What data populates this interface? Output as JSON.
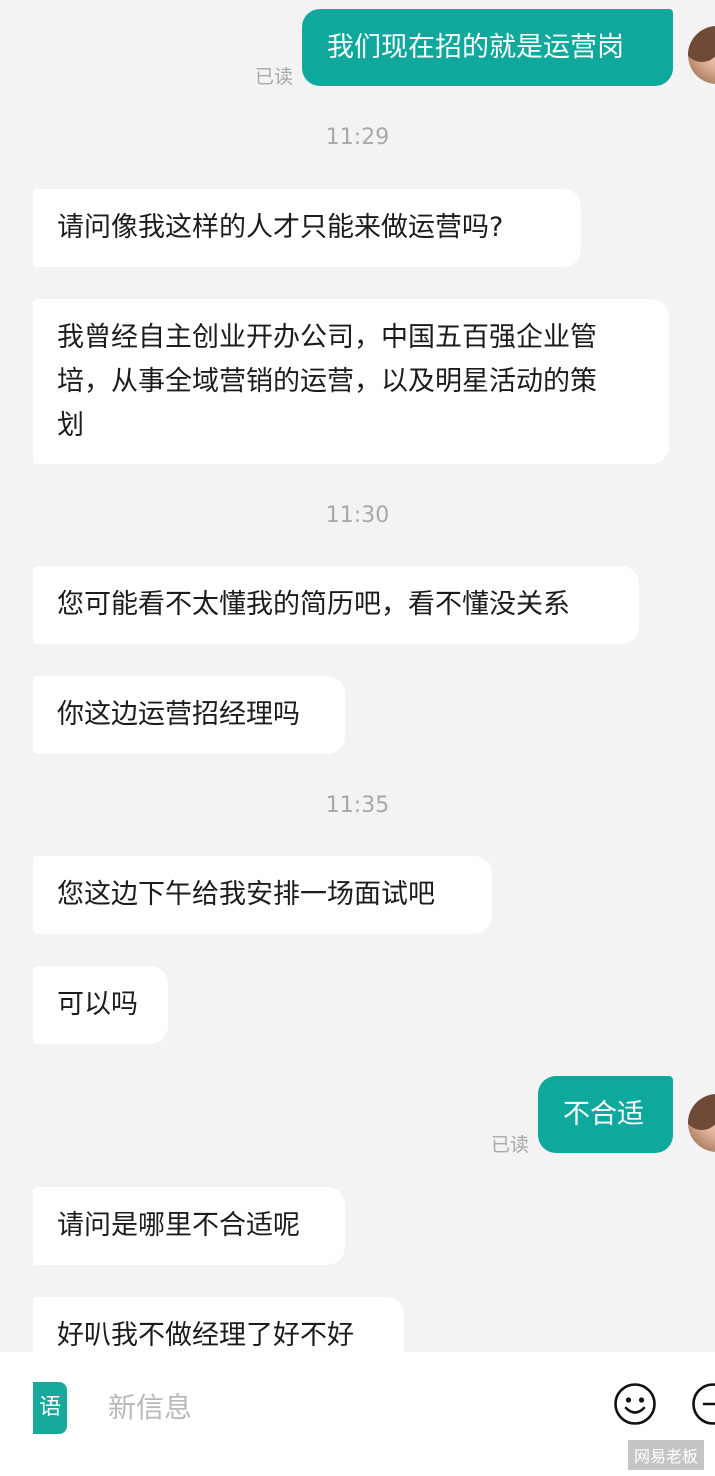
{
  "messages": [
    {
      "text": "我们现在招的就是运营岗",
      "status": "已读"
    },
    {
      "time": "11:29"
    },
    {
      "text": "请问像我这样的人才只能来做运营吗?"
    },
    {
      "lines": [
        "我曾经自主创业开办公司，中国五百强企业管",
        "培，从事全域营销的运营，以及明星活动的策",
        "划"
      ]
    },
    {
      "time": "11:30"
    },
    {
      "text": "您可能看不太懂我的简历吧，看不懂没关系"
    },
    {
      "text": "你这边运营招经理吗"
    },
    {
      "time": "11:35"
    },
    {
      "text": "您这边下午给我安排一场面试吧"
    },
    {
      "text": "可以吗"
    },
    {
      "text": "不合适",
      "status": "已读"
    },
    {
      "text": "请问是哪里不合适呢"
    },
    {
      "text": "好叭我不做经理了好不好"
    }
  ],
  "input": {
    "voice_label": "语",
    "placeholder": "新信息"
  },
  "watermark": "网易老板",
  "colors": {
    "outgoing_bubble": "#0fa89c",
    "incoming_bubble": "#ffffff",
    "background": "#f3f3f3"
  }
}
